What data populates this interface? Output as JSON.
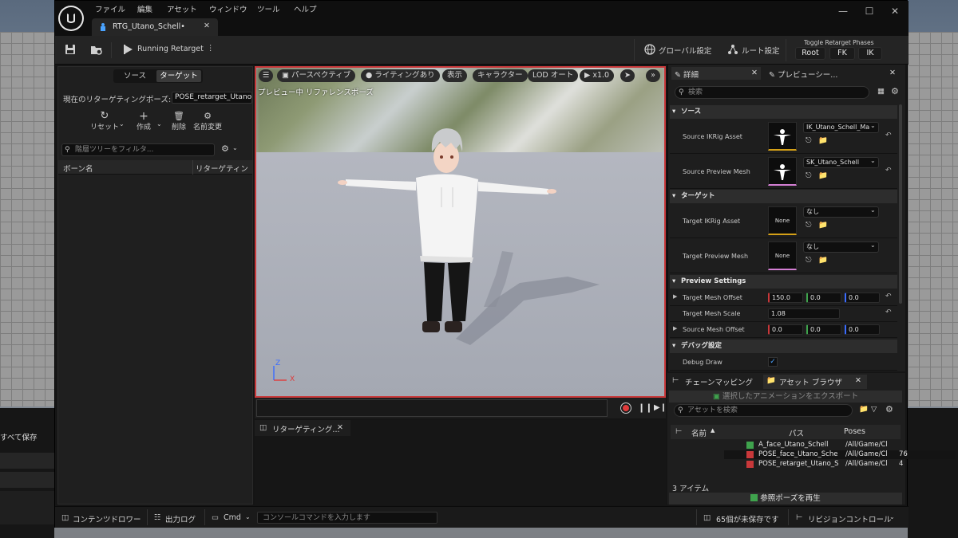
{
  "menu": [
    "ファイル",
    "編集",
    "アセット",
    "ウィンドウ",
    "ツール",
    "ヘルプ"
  ],
  "tab": {
    "title": "RTG_Utano_Schell•"
  },
  "toolbar": {
    "running": "Running Retarget",
    "global_settings": "グローバル設定",
    "root_settings": "ルート設定",
    "phases_title": "Toggle Retarget Phases",
    "phases": [
      "Root",
      "FK",
      "IK"
    ]
  },
  "left_panel": {
    "segments": [
      "ソース",
      "ターゲット"
    ],
    "pose_label": "現在のリターゲティングポーズ:",
    "pose_value": "POSE_retarget_Utano_",
    "actions": [
      "リセット",
      "作成",
      "削除",
      "名前変更"
    ],
    "search_placeholder": "階層ツリーをフィルタ...",
    "col_bone": "ボーン名",
    "col_retarget": "リターゲティン"
  },
  "viewport": {
    "pills": [
      "パースペクティブ",
      "ライティングあり",
      "表示",
      "キャラクター",
      "LOD オート",
      "x1.0"
    ],
    "label": "プレビュー中 リファレンスポーズ",
    "axis_z": "Z",
    "axis_x": "X"
  },
  "log_tab": {
    "title": "リターゲティング..."
  },
  "details": {
    "tabs": [
      "詳細",
      "プレビューシー..."
    ],
    "search_placeholder": "検索",
    "sections": {
      "source": "ソース",
      "target": "ターゲット",
      "preview": "Preview Settings",
      "debug": "デバッグ設定"
    },
    "source_ikrig_label": "Source IKRig Asset",
    "source_ikrig_value": "IK_Utano_Schell_Ma",
    "source_mesh_label": "Source Preview Mesh",
    "source_mesh_value": "SK_Utano_Schell",
    "target_ikrig_label": "Target IKRig Asset",
    "target_ikrig_value": "なし",
    "target_ikrig_thumb": "None",
    "target_mesh_label": "Target Preview Mesh",
    "target_mesh_value": "なし",
    "target_mesh_thumb": "None",
    "target_mesh_offset_label": "Target Mesh Offset",
    "target_mesh_offset": [
      "150.0",
      "0.0",
      "0.0"
    ],
    "target_mesh_scale_label": "Target Mesh Scale",
    "target_mesh_scale": "1.08",
    "source_mesh_offset_label": "Source Mesh Offset",
    "source_mesh_offset": [
      "0.0",
      "0.0",
      "0.0"
    ],
    "debug_draw_label": "Debug Draw",
    "debug_draw_checked": true
  },
  "asset_browser": {
    "tabs": [
      "チェーンマッピング",
      "アセット ブラウザ"
    ],
    "export_label": "選択したアニメーションをエクスポート",
    "search_placeholder": "アセットを検索",
    "columns": [
      "名前",
      "パス",
      "Poses"
    ],
    "rows": [
      {
        "name": "A_face_Utano_Schell",
        "path": "/All/Game/Cl",
        "poses": "",
        "color": "#3fa34d"
      },
      {
        "name": "POSE_face_Utano_Sche",
        "path": "/All/Game/Cl",
        "poses": "76",
        "color": "#c8383a"
      },
      {
        "name": "POSE_retarget_Utano_S",
        "path": "/All/Game/Cl",
        "poses": "4",
        "color": "#c8383a"
      }
    ],
    "count": "3 アイテム",
    "play_ref_pose": "参照ポーズを再生"
  },
  "status_bar": {
    "content_drawer": "コンテンツドロワー",
    "output_log": "出力ログ",
    "cmd": "Cmd",
    "console_placeholder": "コンソールコマンドを入力します",
    "unsaved": "65個が未保存です",
    "revision": "リビジョンコントロール"
  },
  "background": {
    "save_all": "すべて保存"
  }
}
